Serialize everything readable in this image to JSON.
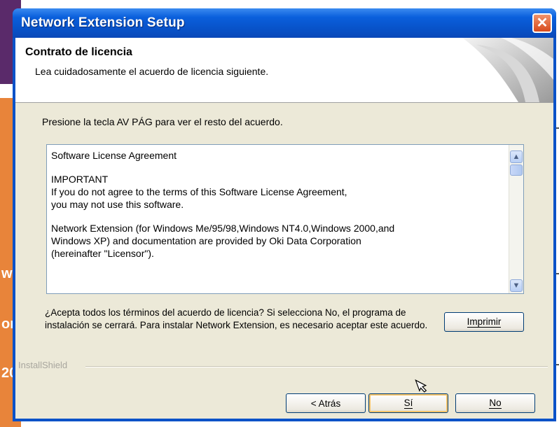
{
  "window": {
    "title": "Network Extension Setup"
  },
  "header": {
    "title": "Contrato de licencia",
    "subtitle": "Lea cuidadosamente el acuerdo de licencia siguiente."
  },
  "instruction": "Presione la tecla AV PÁG para ver el resto del acuerdo.",
  "license": {
    "paragraphs": [
      "Software License Agreement",
      "IMPORTANT\nIf you do not agree to the terms of this Software License Agreement,\nyou may not use this software.",
      "Network Extension (for Windows Me/95/98,Windows NT4.0,Windows 2000,and\nWindows XP) and documentation are provided by Oki Data Corporation\n(hereinafter \"Licensor\")."
    ]
  },
  "question": "¿Acepta todos los términos del acuerdo de licencia? Si selecciona No, el programa de instalación se cerrará. Para instalar Network Extension, es necesario aceptar este acuerdo.",
  "buttons": {
    "print": "Imprimir",
    "back": "< Atrás",
    "yes": "Sí",
    "no": "No"
  },
  "footer": {
    "brand": "InstallShield"
  },
  "background": {
    "fragments": [
      "w",
      "or",
      "20"
    ]
  },
  "colors": {
    "title_bar": "#0a5fdc",
    "dialog_face": "#ece9d8",
    "close_button": "#d84a1c",
    "default_button_highlight": "#f5c46a"
  },
  "icons": [
    "close-icon",
    "scroll-up-icon",
    "scroll-down-icon",
    "mouse-cursor-icon"
  ]
}
